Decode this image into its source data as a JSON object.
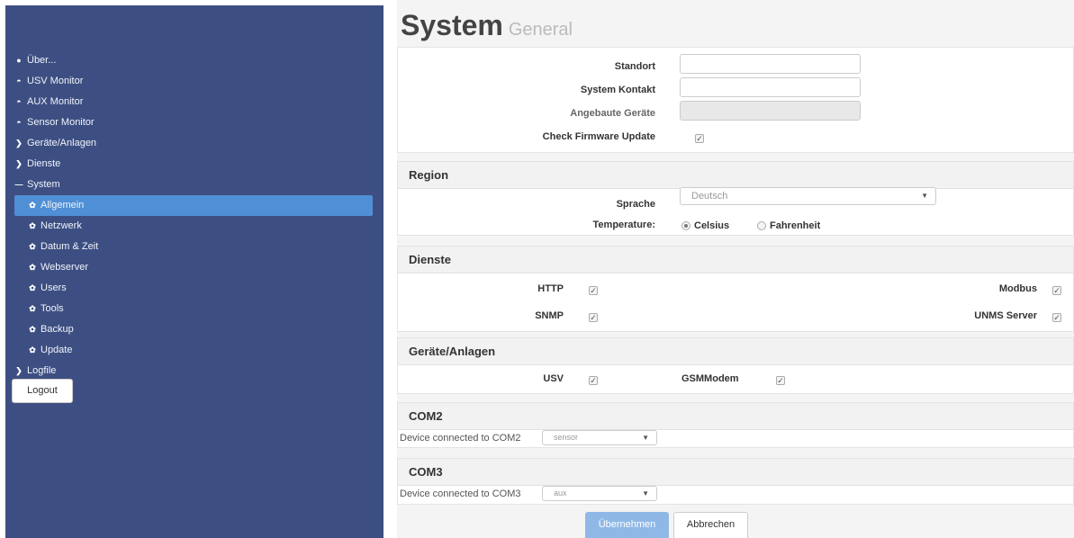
{
  "sidebar": {
    "items": [
      {
        "label": "Über...",
        "icon": "info-icon"
      },
      {
        "label": "USV Monitor",
        "icon": "dashboard-icon"
      },
      {
        "label": "AUX Monitor",
        "icon": "dashboard-icon"
      },
      {
        "label": "Sensor Monitor",
        "icon": "dashboard-icon"
      },
      {
        "label": "Geräte/Anlagen",
        "icon": "chevron-right-icon"
      },
      {
        "label": "Dienste",
        "icon": "chevron-right-icon"
      },
      {
        "label": "System",
        "icon": "minus-icon"
      },
      {
        "label": "Allgemein",
        "icon": "gear-icon",
        "active": true
      },
      {
        "label": "Netzwerk",
        "icon": "gear-icon"
      },
      {
        "label": "Datum & Zeit",
        "icon": "gear-icon"
      },
      {
        "label": "Webserver",
        "icon": "gear-icon"
      },
      {
        "label": "Users",
        "icon": "gear-icon"
      },
      {
        "label": "Tools",
        "icon": "gear-icon"
      },
      {
        "label": "Backup",
        "icon": "gear-icon"
      },
      {
        "label": "Update",
        "icon": "gear-icon"
      },
      {
        "label": "Logfile",
        "icon": "chevron-right-icon"
      }
    ],
    "logout_label": "Logout"
  },
  "page": {
    "title": "System",
    "subtitle": "General"
  },
  "general": {
    "standort_label": "Standort",
    "standort_value": "",
    "kontakt_label": "System Kontakt",
    "kontakt_value": "",
    "angebaute_label": "Angebaute Geräte",
    "angebaute_value": "",
    "firmware_label": "Check Firmware Update",
    "firmware_checked": true
  },
  "region": {
    "heading": "Region",
    "sprache_label": "Sprache",
    "sprache_value": "Deutsch",
    "temp_label": "Temperature:",
    "celsius_label": "Celsius",
    "fahrenheit_label": "Fahrenheit",
    "selected_unit": "Celsius"
  },
  "dienste": {
    "heading": "Dienste",
    "http_label": "HTTP",
    "snmp_label": "SNMP",
    "modbus_label": "Modbus",
    "unms_label": "UNMS Server"
  },
  "geraete": {
    "heading": "Geräte/Anlagen",
    "usv_label": "USV",
    "gsm_label": "GSMModem"
  },
  "com2": {
    "heading": "COM2",
    "label": "Device connected to COM2",
    "value": "sensor"
  },
  "com3": {
    "heading": "COM3",
    "label": "Device connected to COM3",
    "value": "aux"
  },
  "actions": {
    "apply_label": "Übernehmen",
    "cancel_label": "Abbrechen"
  },
  "colors": {
    "sidebar_bg": "#3d4f82",
    "active_item": "#4f8fd6",
    "primary_button": "#8fb8e6"
  }
}
